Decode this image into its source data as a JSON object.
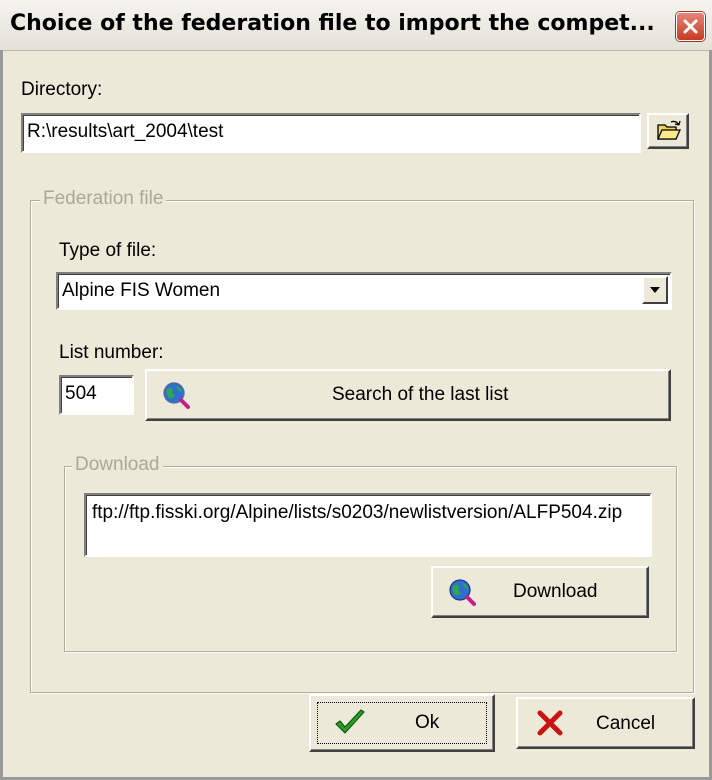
{
  "window": {
    "title": "Choice of the federation file to import the compet..."
  },
  "directory": {
    "label": "Directory:",
    "value": "R:\\results\\art_2004\\test",
    "browse_icon": "open-folder-icon"
  },
  "federation_group": {
    "legend": "Federation file",
    "type_label": "Type of file:",
    "type_value": "Alpine FIS Women",
    "list_label": "List number:",
    "list_value": "504",
    "search_button_label": "Search of the last list",
    "search_icon": "globe-magnifier-icon"
  },
  "download_group": {
    "legend": "Download",
    "url": "ftp://ftp.fisski.org/Alpine/lists/s0203/newlistversion/ALFP504.zip",
    "download_button_label": "Download",
    "download_icon": "globe-magnifier-icon"
  },
  "footer": {
    "ok_label": "Ok",
    "cancel_label": "Cancel",
    "ok_icon": "green-checkmark-icon",
    "cancel_icon": "red-x-icon"
  },
  "colors": {
    "dialog_bg": "#ece9d8",
    "disabled_text": "#aca899",
    "close_button": "#c83a20",
    "ok_check": "#2a9a2a",
    "cancel_x": "#cc1111"
  }
}
